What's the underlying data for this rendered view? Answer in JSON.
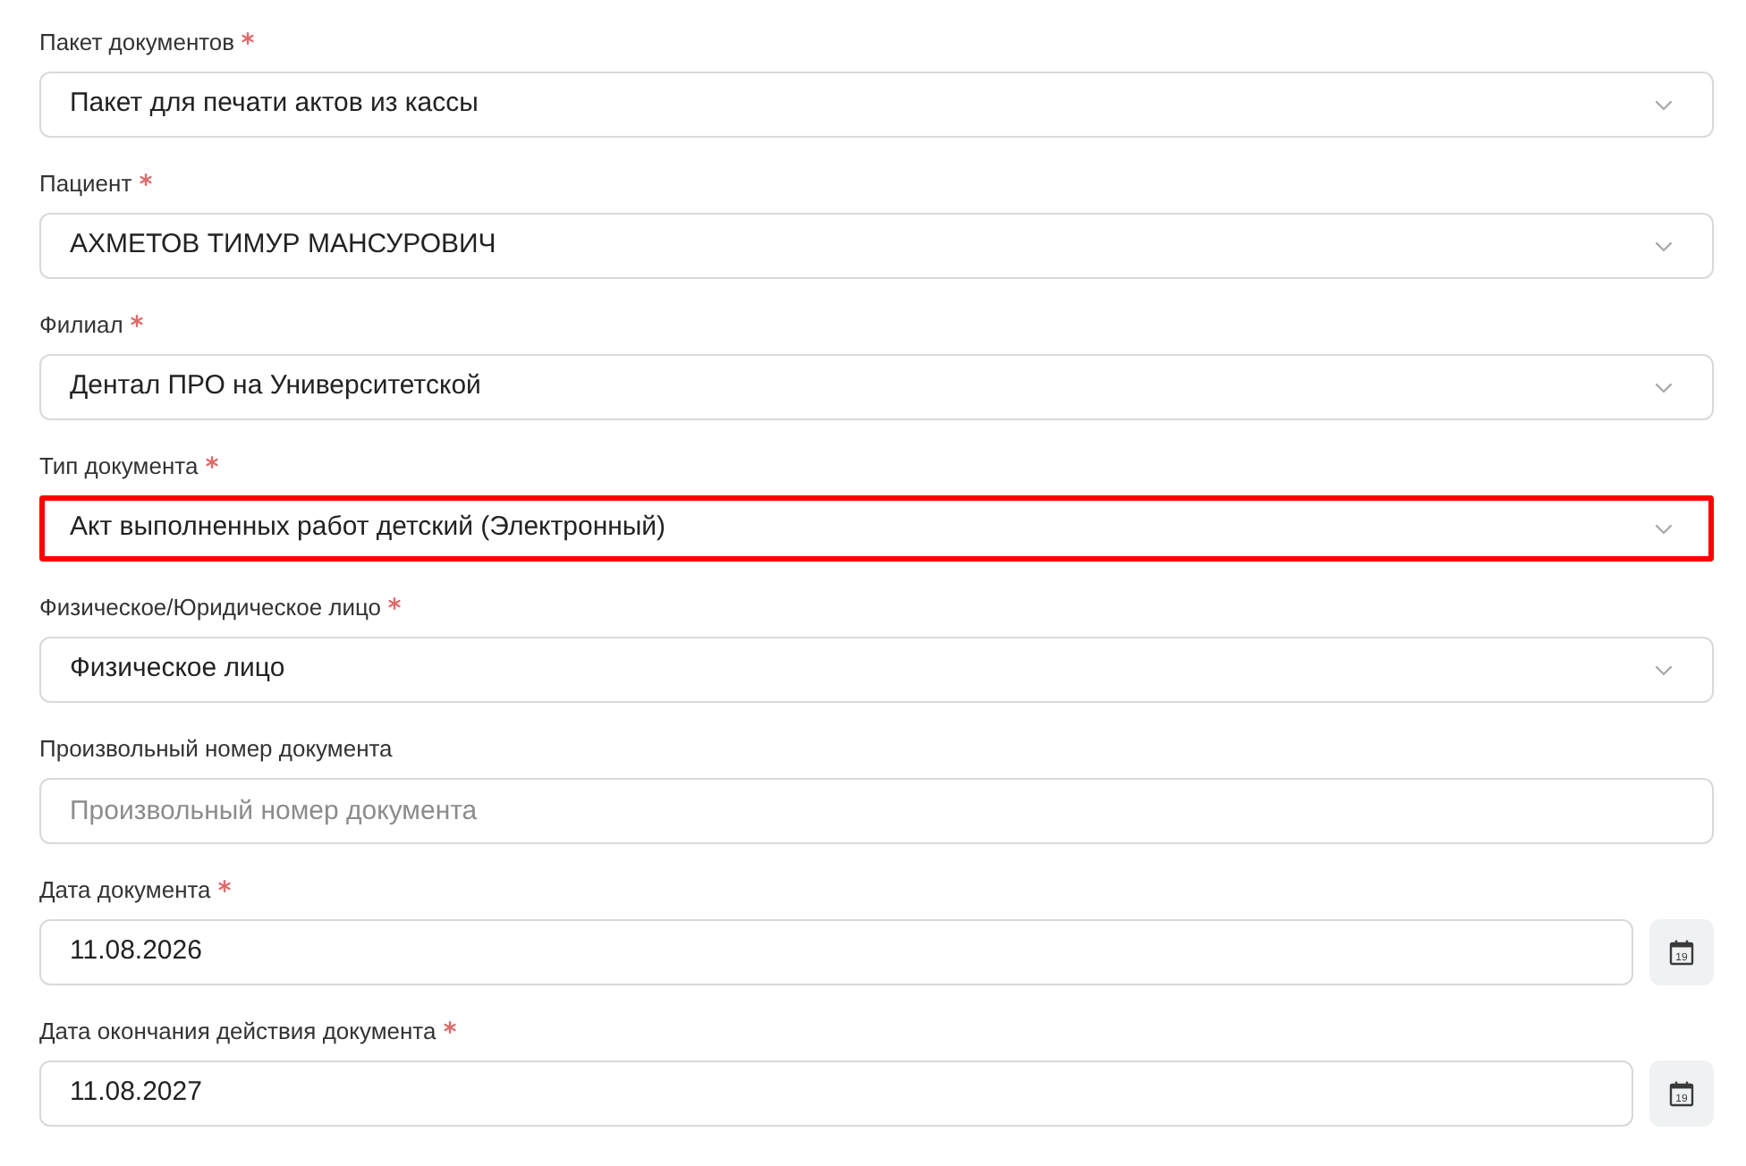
{
  "fields": [
    {
      "kind": "select",
      "label": "Пакет документов",
      "required": true,
      "value": "Пакет для печати актов из кассы",
      "highlighted": false
    },
    {
      "kind": "select",
      "label": "Пациент",
      "required": true,
      "value": "АХМЕТОВ ТИМУР МАНСУРОВИЧ",
      "highlighted": false
    },
    {
      "kind": "select",
      "label": "Филиал",
      "required": true,
      "value": "Дентал ПРО на Университетской",
      "highlighted": false
    },
    {
      "kind": "select",
      "label": "Тип документа",
      "required": true,
      "value": "Акт выполненных работ детский (Электронный)",
      "highlighted": true
    },
    {
      "kind": "select",
      "label": "Физическое/Юридическое лицо",
      "required": true,
      "value": "Физическое лицо",
      "highlighted": false
    },
    {
      "kind": "text",
      "label": "Произвольный номер документа",
      "required": false,
      "placeholder": "Произвольный номер документа",
      "highlighted": false
    },
    {
      "kind": "date",
      "label": "Дата документа",
      "required": true,
      "value": "11.08.2026",
      "highlighted": false,
      "calendar_day": "19"
    },
    {
      "kind": "date",
      "label": "Дата окончания действия документа",
      "required": true,
      "value": "11.08.2027",
      "highlighted": false,
      "calendar_day": "19"
    }
  ]
}
